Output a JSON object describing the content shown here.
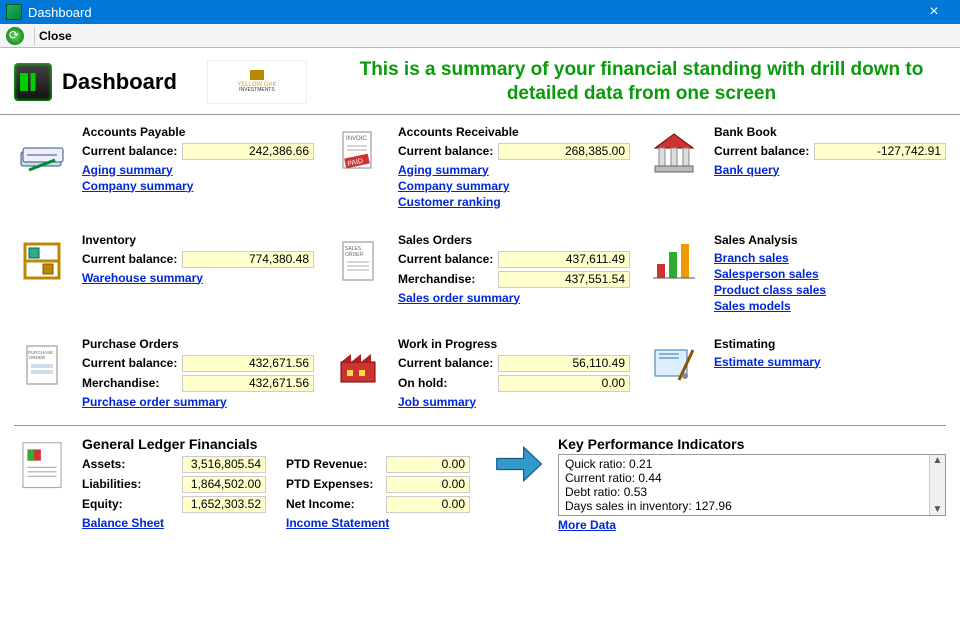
{
  "window": {
    "title": "Dashboard"
  },
  "toolbar": {
    "close": "Close"
  },
  "header": {
    "title": "Dashboard",
    "logo_name": "YELLOW OAK",
    "tagline": "This is a summary of your financial standing with drill down to detailed data from one screen"
  },
  "widgets": {
    "ap": {
      "title": "Accounts Payable",
      "balance_label": "Current balance:",
      "balance": "242,386.66",
      "links": [
        "Aging summary",
        "Company summary"
      ]
    },
    "ar": {
      "title": "Accounts Receivable",
      "balance_label": "Current balance:",
      "balance": "268,385.00",
      "links": [
        "Aging summary",
        "Company summary",
        "Customer ranking"
      ]
    },
    "bank": {
      "title": "Bank Book",
      "balance_label": "Current balance:",
      "balance": "-127,742.91",
      "links": [
        "Bank query"
      ]
    },
    "inv": {
      "title": "Inventory",
      "balance_label": "Current balance:",
      "balance": "774,380.48",
      "links": [
        "Warehouse summary"
      ]
    },
    "so": {
      "title": "Sales Orders",
      "balance_label": "Current balance:",
      "balance": "437,611.49",
      "merch_label": "Merchandise:",
      "merch": "437,551.54",
      "links": [
        "Sales order summary"
      ]
    },
    "sa": {
      "title": "Sales Analysis",
      "links": [
        "Branch sales",
        "Salesperson sales",
        "Product class sales",
        "Sales models"
      ]
    },
    "po": {
      "title": "Purchase Orders",
      "balance_label": "Current balance:",
      "balance": "432,671.56",
      "merch_label": "Merchandise:",
      "merch": "432,671.56",
      "links": [
        "Purchase order summary"
      ]
    },
    "wip": {
      "title": "Work in Progress",
      "balance_label": "Current balance:",
      "balance": "56,110.49",
      "hold_label": "On hold:",
      "hold": "0.00",
      "links": [
        "Job summary"
      ]
    },
    "est": {
      "title": "Estimating",
      "links": [
        "Estimate summary"
      ]
    }
  },
  "gl": {
    "title": "General Ledger Financials",
    "assets_label": "Assets:",
    "assets": "3,516,805.54",
    "liab_label": "Liabilities:",
    "liab": "1,864,502.00",
    "equity_label": "Equity:",
    "equity": "1,652,303.52",
    "bs_link": "Balance Sheet",
    "ptdrev_label": "PTD Revenue:",
    "ptdrev": "0.00",
    "ptdexp_label": "PTD Expenses:",
    "ptdexp": "0.00",
    "netinc_label": "Net Income:",
    "netinc": "0.00",
    "is_link": "Income Statement"
  },
  "kpi": {
    "title": "Key Performance Indicators",
    "items": [
      "Quick ratio: 0.21",
      "Current ratio: 0.44",
      "Debt ratio: 0.53",
      "Days sales in inventory: 127.96"
    ],
    "more": "More Data"
  }
}
